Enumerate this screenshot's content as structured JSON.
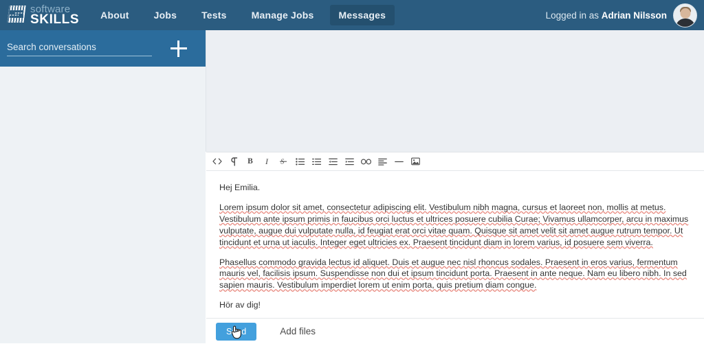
{
  "colors": {
    "nav_bg": "#2b5c80",
    "nav_active_bg": "#24506f",
    "search_panel_bg": "#2b6c9c",
    "sidebar_bg": "#eef2f5",
    "thread_bg": "#eceff3",
    "send_button_bg": "#43a0dd",
    "spellcheck_underline": "#e8897f",
    "text": "#333333"
  },
  "nav": {
    "logo": {
      "line1": "software",
      "line2": "SKILLS",
      "icon": "stacked-blocks-logo-icon"
    },
    "items": [
      {
        "label": "About",
        "active": false
      },
      {
        "label": "Jobs",
        "active": false
      },
      {
        "label": "Tests",
        "active": false
      },
      {
        "label": "Manage Jobs",
        "active": false
      },
      {
        "label": "Messages",
        "active": true
      }
    ],
    "login": {
      "prefix": "Logged in as ",
      "user": "Adrian Nilsson",
      "avatar": "user-avatar-photo"
    }
  },
  "sidebar": {
    "search": {
      "placeholder": "Search conversations",
      "value": ""
    },
    "new_conversation_button": {
      "icon": "plus-icon",
      "label": "+"
    },
    "conversations": []
  },
  "editor": {
    "toolbar": [
      {
        "name": "source-code-icon",
        "title": "Code view"
      },
      {
        "name": "paragraph-pilcrow-icon",
        "title": "Paragraph format"
      },
      {
        "name": "bold-icon",
        "title": "Bold"
      },
      {
        "name": "italic-icon",
        "title": "Italic"
      },
      {
        "name": "strikethrough-icon",
        "title": "Strikethrough"
      },
      {
        "name": "unordered-list-icon",
        "title": "Bulleted list"
      },
      {
        "name": "ordered-list-icon",
        "title": "Numbered list"
      },
      {
        "name": "outdent-icon",
        "title": "Decrease indent"
      },
      {
        "name": "indent-icon",
        "title": "Increase indent"
      },
      {
        "name": "link-icon",
        "title": "Insert link"
      },
      {
        "name": "align-left-icon",
        "title": "Align left"
      },
      {
        "name": "horizontal-rule-icon",
        "title": "Horizontal line"
      },
      {
        "name": "insert-image-icon",
        "title": "Insert image"
      }
    ],
    "message": {
      "greeting": "Hej Emilia.",
      "paragraph_1": "Lorem ipsum dolor sit amet, consectetur adipiscing elit. Vestibulum nibh magna, cursus et laoreet non, mollis at metus. Vestibulum ante ipsum primis in faucibus orci luctus et ultrices posuere cubilia Curae; Vivamus ullamcorper, arcu in maximus vulputate, augue dui vulputate nulla, id feugiat erat orci vitae quam. Quisque sit amet velit sit amet augue rutrum tempor. Ut tincidunt et urna ut iaculis. Integer eget ultricies ex. Praesent tincidunt diam in lorem varius, id posuere sem viverra.",
      "paragraph_2": "Phasellus commodo gravida lectus id aliquet. Duis et augue nec nisl rhoncus sodales. Praesent in eros varius, fermentum mauris vel, facilisis ipsum. Suspendisse non dui et ipsum tincidunt porta. Praesent in ante neque. Nam eu libero nibh. In sed sapien mauris. Vestibulum imperdiet lorem ut enim porta, quis pretium diam congue.",
      "closing": "Hör av dig!"
    },
    "actions": {
      "send_label": "Send",
      "add_files_label": "Add files"
    }
  }
}
